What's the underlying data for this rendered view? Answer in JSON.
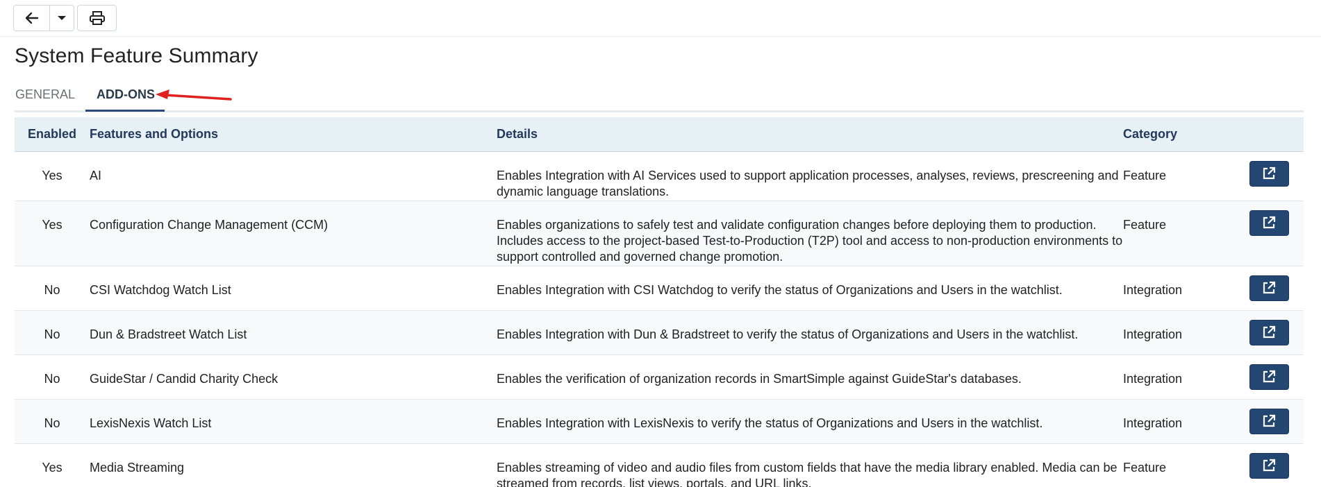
{
  "page": {
    "title": "System Feature Summary"
  },
  "tabs": [
    {
      "label": "GENERAL",
      "active": false
    },
    {
      "label": "ADD-ONS",
      "active": true
    }
  ],
  "toolbar": {
    "back_icon": "arrow-left-icon",
    "dropdown_icon": "caret-down-icon",
    "print_icon": "printer-icon"
  },
  "table": {
    "headers": [
      "Enabled",
      "Features and Options",
      "Details",
      "Category",
      ""
    ],
    "rows": [
      {
        "enabled": "Yes",
        "feature": "AI",
        "details": "Enables Integration with AI Services used to support application processes, analyses, reviews, prescreening and dynamic language translations.",
        "category": "Feature"
      },
      {
        "enabled": "Yes",
        "feature": "Configuration Change Management (CCM)",
        "details": "Enables organizations to safely test and validate configuration changes before deploying them to production. Includes access to the project-based Test-to-Production (T2P) tool and access to non-production environments to support controlled and governed change promotion.",
        "category": "Feature"
      },
      {
        "enabled": "No",
        "feature": "CSI Watchdog Watch List",
        "details": "Enables Integration with CSI Watchdog to verify the status of Organizations and Users in the watchlist.",
        "category": "Integration"
      },
      {
        "enabled": "No",
        "feature": "Dun & Bradstreet Watch List",
        "details": "Enables Integration with Dun & Bradstreet to verify the status of Organizations and Users in the watchlist.",
        "category": "Integration"
      },
      {
        "enabled": "No",
        "feature": "GuideStar / Candid Charity Check",
        "details": "Enables the verification of organization records in SmartSimple against GuideStar's databases.",
        "category": "Integration"
      },
      {
        "enabled": "No",
        "feature": "LexisNexis Watch List",
        "details": "Enables Integration with LexisNexis to verify the status of Organizations and Users in the watchlist.",
        "category": "Integration"
      },
      {
        "enabled": "Yes",
        "feature": "Media Streaming",
        "details": "Enables streaming of video and audio files from custom fields that have the media library enabled. Media can be streamed from records, list views, portals, and URL links.",
        "category": "Feature"
      }
    ]
  },
  "colors": {
    "header_bg": "#e7f0f4",
    "header_text": "#23395b",
    "action_button": "#234673",
    "tab_underline": "#2b4a78",
    "annotation_arrow": "#e02020"
  }
}
